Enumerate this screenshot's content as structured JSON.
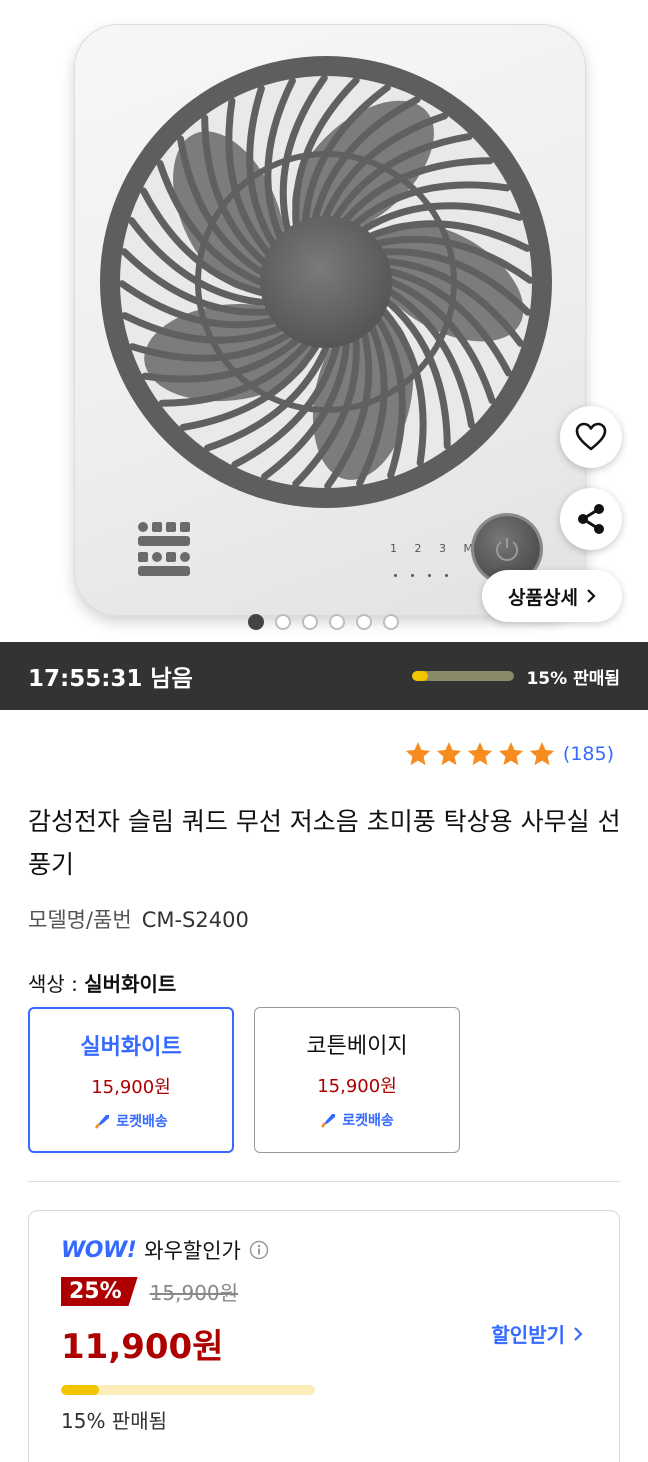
{
  "hero": {
    "image_alt": "감성전자 슬림 쿼드 무선 저소음 초미풍 탁상용 사무실 선풍기",
    "speed_labels": "1 2 3 M",
    "detail_button_label": "상품상세",
    "carousel": {
      "total": 6,
      "active_index": 0
    },
    "icons": {
      "wishlist": "heart-outline-icon",
      "share": "share-icon",
      "detail": "chevron-right-icon"
    }
  },
  "countdown": {
    "time_left": "17:55:31 남음",
    "sold_percent": 15,
    "sold_label": "15% 판매됨"
  },
  "product": {
    "rating_stars": 5,
    "review_count": "(185)",
    "title": "감성전자 슬림 쿼드 무선 저소음 초미풍 탁상용 사무실 선풍기",
    "model_label": "모델명/품번",
    "model_value": "CM-S2400",
    "color_label": "색상 : ",
    "color_selected": "실버화이트",
    "options": [
      {
        "name": "실버화이트",
        "price": "15,900원",
        "shipping": "로켓배송",
        "selected": true
      },
      {
        "name": "코튼베이지",
        "price": "15,900원",
        "shipping": "로켓배송",
        "selected": false
      }
    ]
  },
  "wow": {
    "logo": "WOW!",
    "label": "와우할인가",
    "discount_rate": "25%",
    "original_price": "15,900원",
    "sale_price": "11,900원",
    "get_discount_label": "할인받기",
    "sold_percent": 15,
    "sold_label": "15% 판매됨"
  },
  "colors": {
    "accent_blue": "#346aff",
    "price_red": "#ae0000",
    "star_orange": "#f68b1f",
    "progress_yellow": "#f3c400",
    "countdown_bg": "#333333"
  }
}
